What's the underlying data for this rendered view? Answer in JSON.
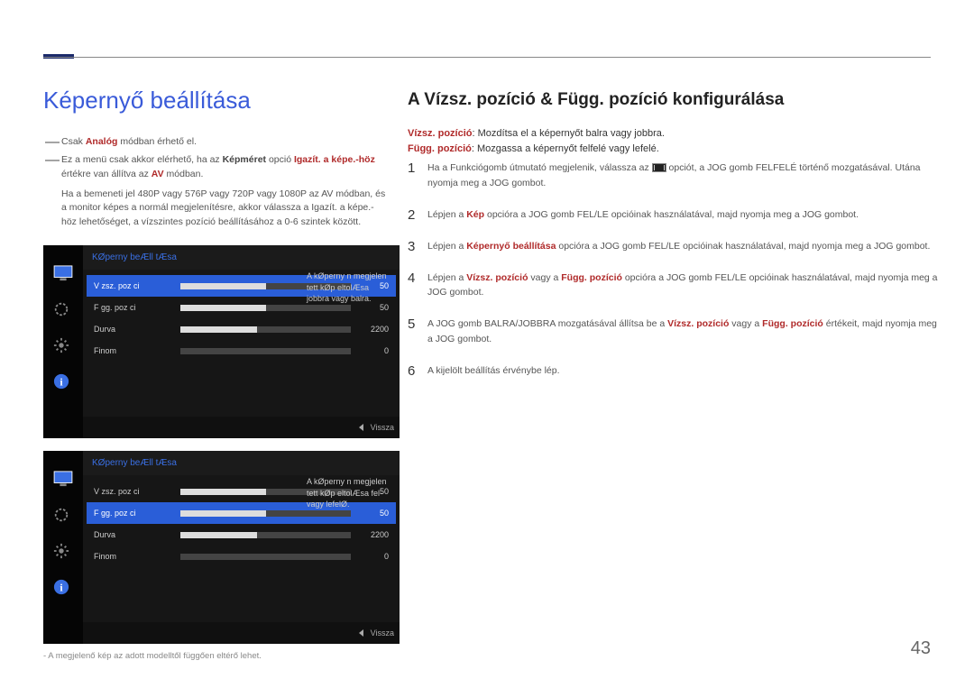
{
  "page_title": "Képernyő beállítása",
  "section_title": "A Vízsz. pozíció & Függ. pozíció konfigurálása",
  "desc_vsz_label": "Vízsz. pozíció",
  "desc_vsz_text": ": Mozdítsa el a képernyőt balra vagy jobbra.",
  "desc_fgg_label": "Függ. pozíció",
  "desc_fgg_text": ": Mozgassa a képernyőt felfelé vagy lefelé.",
  "notes": [
    {
      "dash": "―",
      "pre": "Csak ",
      "bold": "Analóg",
      "post": " módban érhető el."
    },
    {
      "dash": "―",
      "pre": "Ez a menü csak akkor elérhető, ha az ",
      "b1": "Képméret",
      "mid": " opció ",
      "b2": "Igazít. a képe.-höz",
      "post": " értékre van állítva az ",
      "b3": "AV",
      "tail": " módban."
    }
  ],
  "note_sub_pre": "Ha a bemeneti jel 480P vagy 576P vagy 720P vagy 1080P az ",
  "note_sub_b1": "AV",
  "note_sub_mid": " módban, és a monitor képes a normál megjelenítésre, akkor válassza a ",
  "note_sub_b2": "Igazít. a képe.-höz",
  "note_sub_post": " lehetőséget, a vízszintes pozíció beállításához a 0-6 szintek között.",
  "steps": [
    {
      "n": "1",
      "parts": [
        "Ha a Funkciógomb útmutató megjelenik, válassza az ",
        " opciót, a JOG gomb FELFELÉ történő mozgatásával. Utána nyomja meg a JOG gombot."
      ],
      "icon": true
    },
    {
      "n": "2",
      "pre": "Lépjen a ",
      "bold": "Kép",
      "post": " opcióra a JOG gomb FEL/LE opcióinak használatával, majd nyomja meg a JOG gombot."
    },
    {
      "n": "3",
      "pre": "Lépjen a ",
      "bold": "Képernyő beállítása",
      "post": " opcióra a JOG gomb FEL/LE opcióinak használatával, majd nyomja meg a JOG gombot."
    },
    {
      "n": "4",
      "pre": "Lépjen a ",
      "bold": "Vízsz. pozíció",
      "mid": " vagy a ",
      "bold2": "Függ. pozíció",
      "post": " opcióra a JOG gomb FEL/LE opcióinak használatával, majd nyomja meg a JOG gombot."
    },
    {
      "n": "5",
      "pre": "A JOG gomb BALRA/JOBBRA mozgatásával állítsa be a ",
      "bold": "Vízsz. pozíció",
      "mid": " vagy a ",
      "bold2": "Függ. pozíció",
      "post": " értékeit, majd nyomja meg a JOG gombot."
    },
    {
      "n": "6",
      "pre": "A kijelölt beállítás érvénybe lép."
    }
  ],
  "osd": {
    "header": "KØperny  beÆll tÆsa",
    "rows": [
      {
        "label": "V zsz. poz ci ",
        "value": "50",
        "fill": 50
      },
      {
        "label": "F gg. poz ci ",
        "value": "50",
        "fill": 50
      },
      {
        "label": "Durva",
        "value": "2200",
        "fill": 45
      },
      {
        "label": "Finom",
        "value": "0",
        "fill": 0
      }
    ],
    "desc1": "A kØperny n megjelen tett kØp eltolÆsa jobbra vagy balra.",
    "desc2": "A kØperny n megjelen tett kØp eltolÆsa fel- vagy lefelØ.",
    "footer": "Vissza"
  },
  "footnote": "-  A megjelenő kép az adott modelltől függően eltérő lehet.",
  "page_num": "43"
}
